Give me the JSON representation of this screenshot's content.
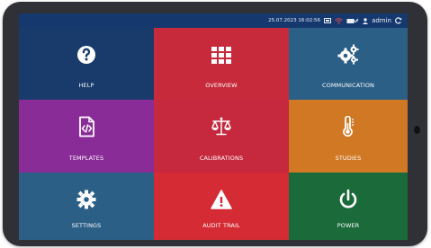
{
  "status": {
    "datetime": "25.07.2023 16:02:56",
    "user": "admin",
    "icons": [
      "screen-icon",
      "wifi-icon",
      "battery-plug-icon",
      "user-icon",
      "refresh-icon"
    ]
  },
  "colors": {
    "navy": "#183b6b",
    "red": "#c6283d",
    "steel": "#2b5f86",
    "purple": "#8a2c98",
    "orange": "#d07824",
    "green": "#1b6b3a"
  },
  "tiles": [
    {
      "label": "HELP",
      "icon": "help-icon",
      "color": "#183b6b"
    },
    {
      "label": "OVERVIEW",
      "icon": "grid-icon",
      "color": "#c62a3b"
    },
    {
      "label": "COMMUNICATION",
      "icon": "gears-icon",
      "color": "#2b5f86"
    },
    {
      "label": "TEMPLATES",
      "icon": "code-file-icon",
      "color": "#8a2c98"
    },
    {
      "label": "CALIBRATIONS",
      "icon": "scale-icon",
      "color": "#c6283d"
    },
    {
      "label": "STUDIES",
      "icon": "thermometer-icon",
      "color": "#d07824"
    },
    {
      "label": "SETTINGS",
      "icon": "gear-icon",
      "color": "#2b5f86"
    },
    {
      "label": "AUDIT TRAIL",
      "icon": "warning-icon",
      "color": "#d42b35"
    },
    {
      "label": "POWER",
      "icon": "power-icon",
      "color": "#1b6b3a"
    }
  ]
}
